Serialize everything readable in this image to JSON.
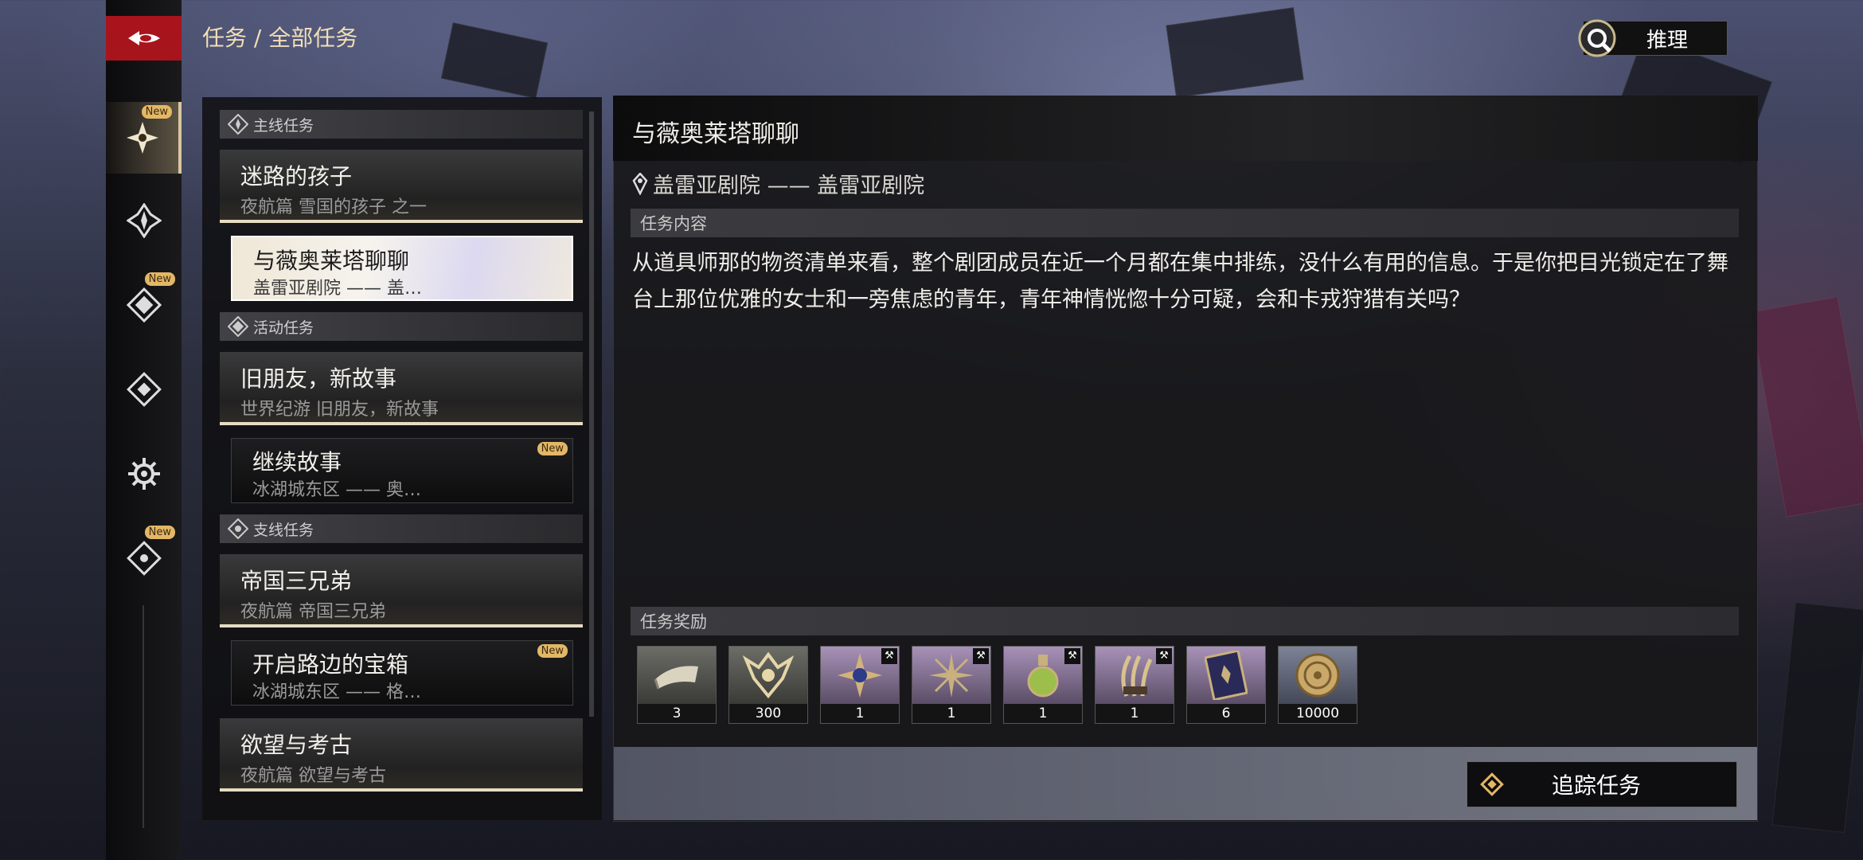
{
  "header": {
    "breadcrumb": "任务 / 全部任务",
    "reason_button": "推理"
  },
  "rail": {
    "new_label": "New",
    "items": [
      {
        "icon": "flower-icon",
        "active": true,
        "new": true
      },
      {
        "icon": "main-quest-icon",
        "active": false,
        "new": false
      },
      {
        "icon": "event-quest-icon",
        "active": false,
        "new": true
      },
      {
        "icon": "diamond-icon",
        "active": false,
        "new": false
      },
      {
        "icon": "gear-icon",
        "active": false,
        "new": false
      },
      {
        "icon": "side-quest-icon",
        "active": false,
        "new": true
      }
    ]
  },
  "quest_list": {
    "categories": [
      {
        "label": "主线任务"
      },
      {
        "label": "活动任务"
      },
      {
        "label": "支线任务"
      }
    ],
    "quests": [
      {
        "title": "迷路的孩子",
        "subtitle": "夜航篇 雪国的孩子 之一"
      },
      {
        "title": "与薇奥莱塔聊聊",
        "subtitle": "盖雷亚剧院 —— 盖…"
      },
      {
        "title": "旧朋友，新故事",
        "subtitle": "世界纪游 旧朋友，新故事"
      },
      {
        "title": "继续故事",
        "subtitle": "冰湖城东区 —— 奥…"
      },
      {
        "title": "帝国三兄弟",
        "subtitle": "夜航篇 帝国三兄弟"
      },
      {
        "title": "开启路边的宝箱",
        "subtitle": "冰湖城东区 —— 格…"
      },
      {
        "title": "欲望与考古",
        "subtitle": "夜航篇 欲望与考古"
      }
    ]
  },
  "detail": {
    "title": "与薇奥莱塔聊聊",
    "location": "盖雷亚剧院 —— 盖雷亚剧院",
    "content_header": "任务内容",
    "description": "从道具师那的物资清单来看，整个剧团成员在近一个月都在集中排练，没什么有用的信息。于是你把目光锁定在了舞台上那位优雅的女士和一旁焦虑的青年，青年神情恍惚十分可疑，会和卡戎狩猎有关吗？",
    "rewards_header": "任务奖励",
    "rewards": [
      {
        "count": "3",
        "icon": "scroll-icon"
      },
      {
        "count": "300",
        "icon": "emblem-icon"
      },
      {
        "count": "1",
        "icon": "compass-icon"
      },
      {
        "count": "1",
        "icon": "star-weapon-icon"
      },
      {
        "count": "1",
        "icon": "potion-icon"
      },
      {
        "count": "1",
        "icon": "claw-icon"
      },
      {
        "count": "6",
        "icon": "book-icon"
      },
      {
        "count": "10000",
        "icon": "coin-icon"
      }
    ],
    "track_button": "追踪任务"
  },
  "colors": {
    "accent_red": "#a8141c",
    "new_badge": "#e3b765",
    "breadcrumb": "#f1dfb6"
  }
}
